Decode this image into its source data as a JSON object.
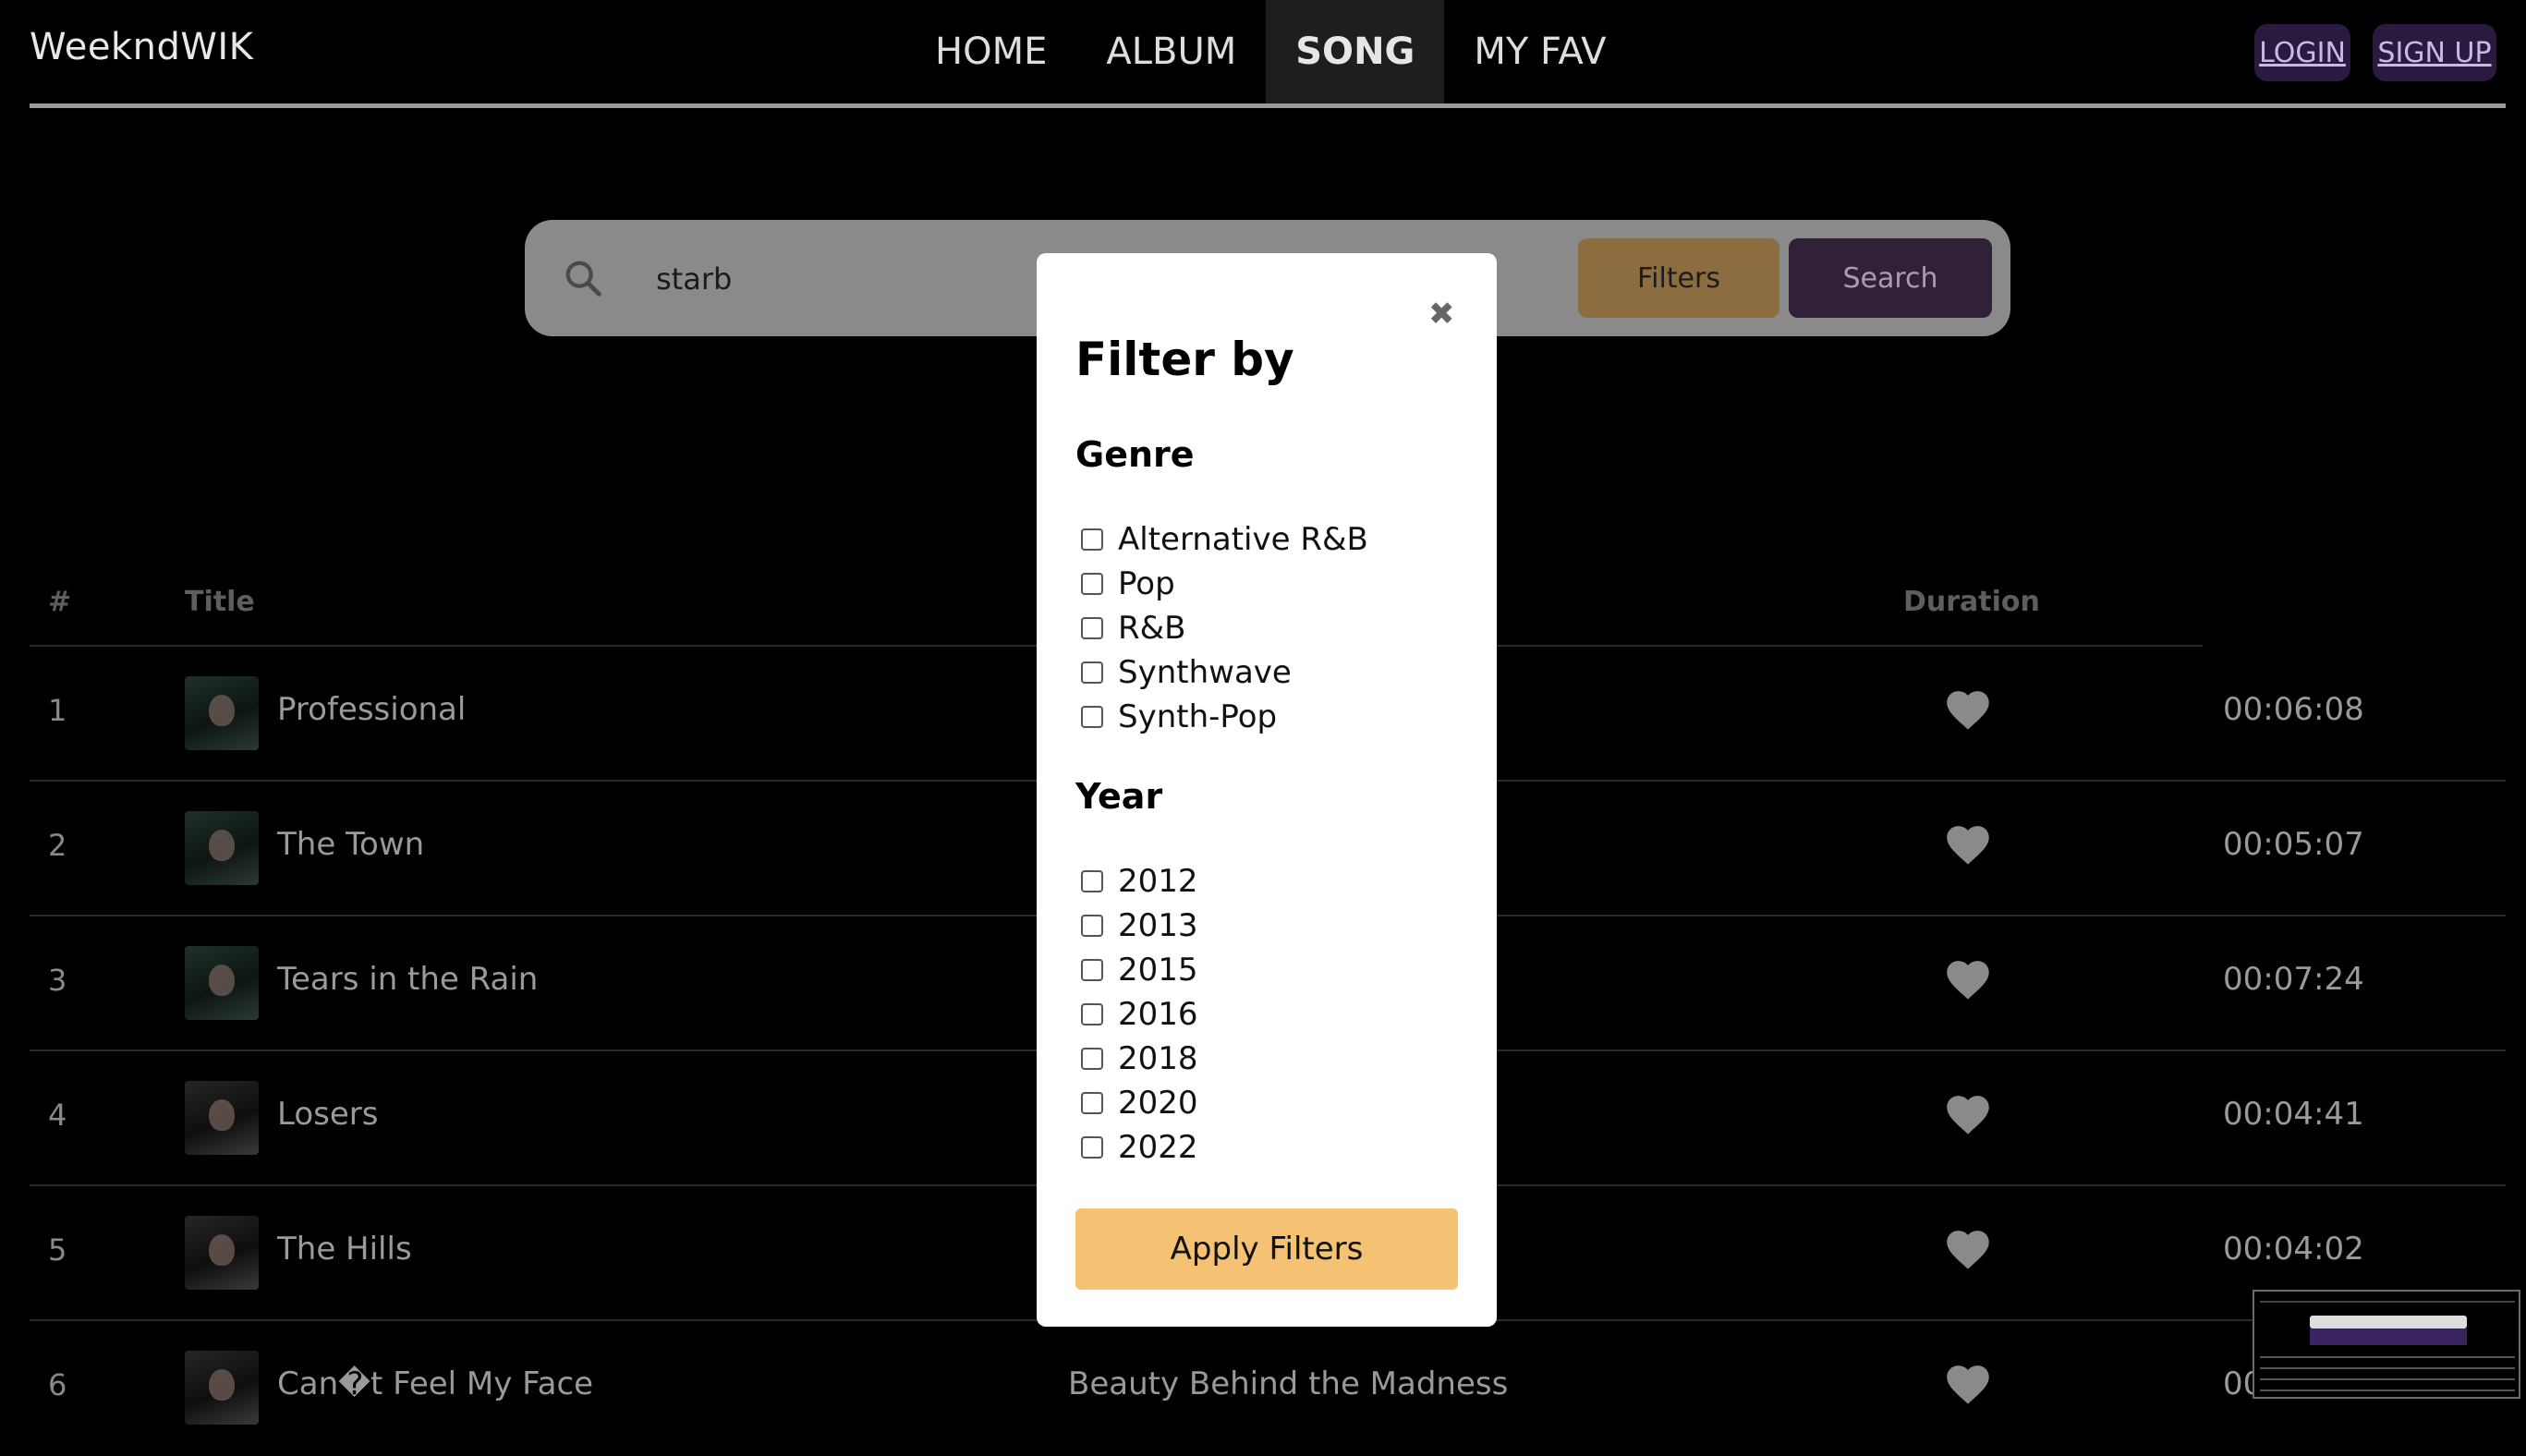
{
  "app": {
    "logo": "WeekndWIK"
  },
  "nav": {
    "items": [
      {
        "label": "HOME",
        "active": false
      },
      {
        "label": "ALBUM",
        "active": false
      },
      {
        "label": "SONG",
        "active": true
      },
      {
        "label": "MY FAV",
        "active": false
      }
    ],
    "login_label": "LOGIN",
    "signup_label": "SIGN UP"
  },
  "search": {
    "value": "starb",
    "placeholder": "",
    "filters_label": "Filters",
    "search_label": "Search"
  },
  "table": {
    "headers": {
      "num": "#",
      "title": "Title",
      "duration": "Duration"
    },
    "rows": [
      {
        "num": "1",
        "title": "Professional",
        "album": "",
        "duration": "00:06:08",
        "thumb": "dark1"
      },
      {
        "num": "2",
        "title": "The Town",
        "album": "",
        "duration": "00:05:07",
        "thumb": "dark1"
      },
      {
        "num": "3",
        "title": "Tears in the Rain",
        "album": "",
        "duration": "00:07:24",
        "thumb": "dark1"
      },
      {
        "num": "4",
        "title": "Losers",
        "album": "",
        "duration": "00:04:41",
        "thumb": "dark2"
      },
      {
        "num": "5",
        "title": "The Hills",
        "album": "",
        "duration": "00:04:02",
        "thumb": "dark2"
      },
      {
        "num": "6",
        "title": "Can�t Feel My Face",
        "album": "Beauty Behind the Madness",
        "duration": "00:0",
        "thumb": "dark2"
      }
    ]
  },
  "modal": {
    "title": "Filter by",
    "close_icon": "close-icon",
    "genre_title": "Genre",
    "genres": [
      "Alternative R&B",
      "Pop",
      "R&B",
      "Synthwave",
      "Synth-Pop"
    ],
    "year_title": "Year",
    "years": [
      "2012",
      "2013",
      "2015",
      "2016",
      "2018",
      "2020",
      "2022"
    ],
    "apply_label": "Apply Filters"
  },
  "colors": {
    "background": "#000000",
    "filters_button": "#8c6d3f",
    "search_button": "#302139",
    "apply_button": "#f4c272",
    "auth_button": "#2a1a3f"
  }
}
